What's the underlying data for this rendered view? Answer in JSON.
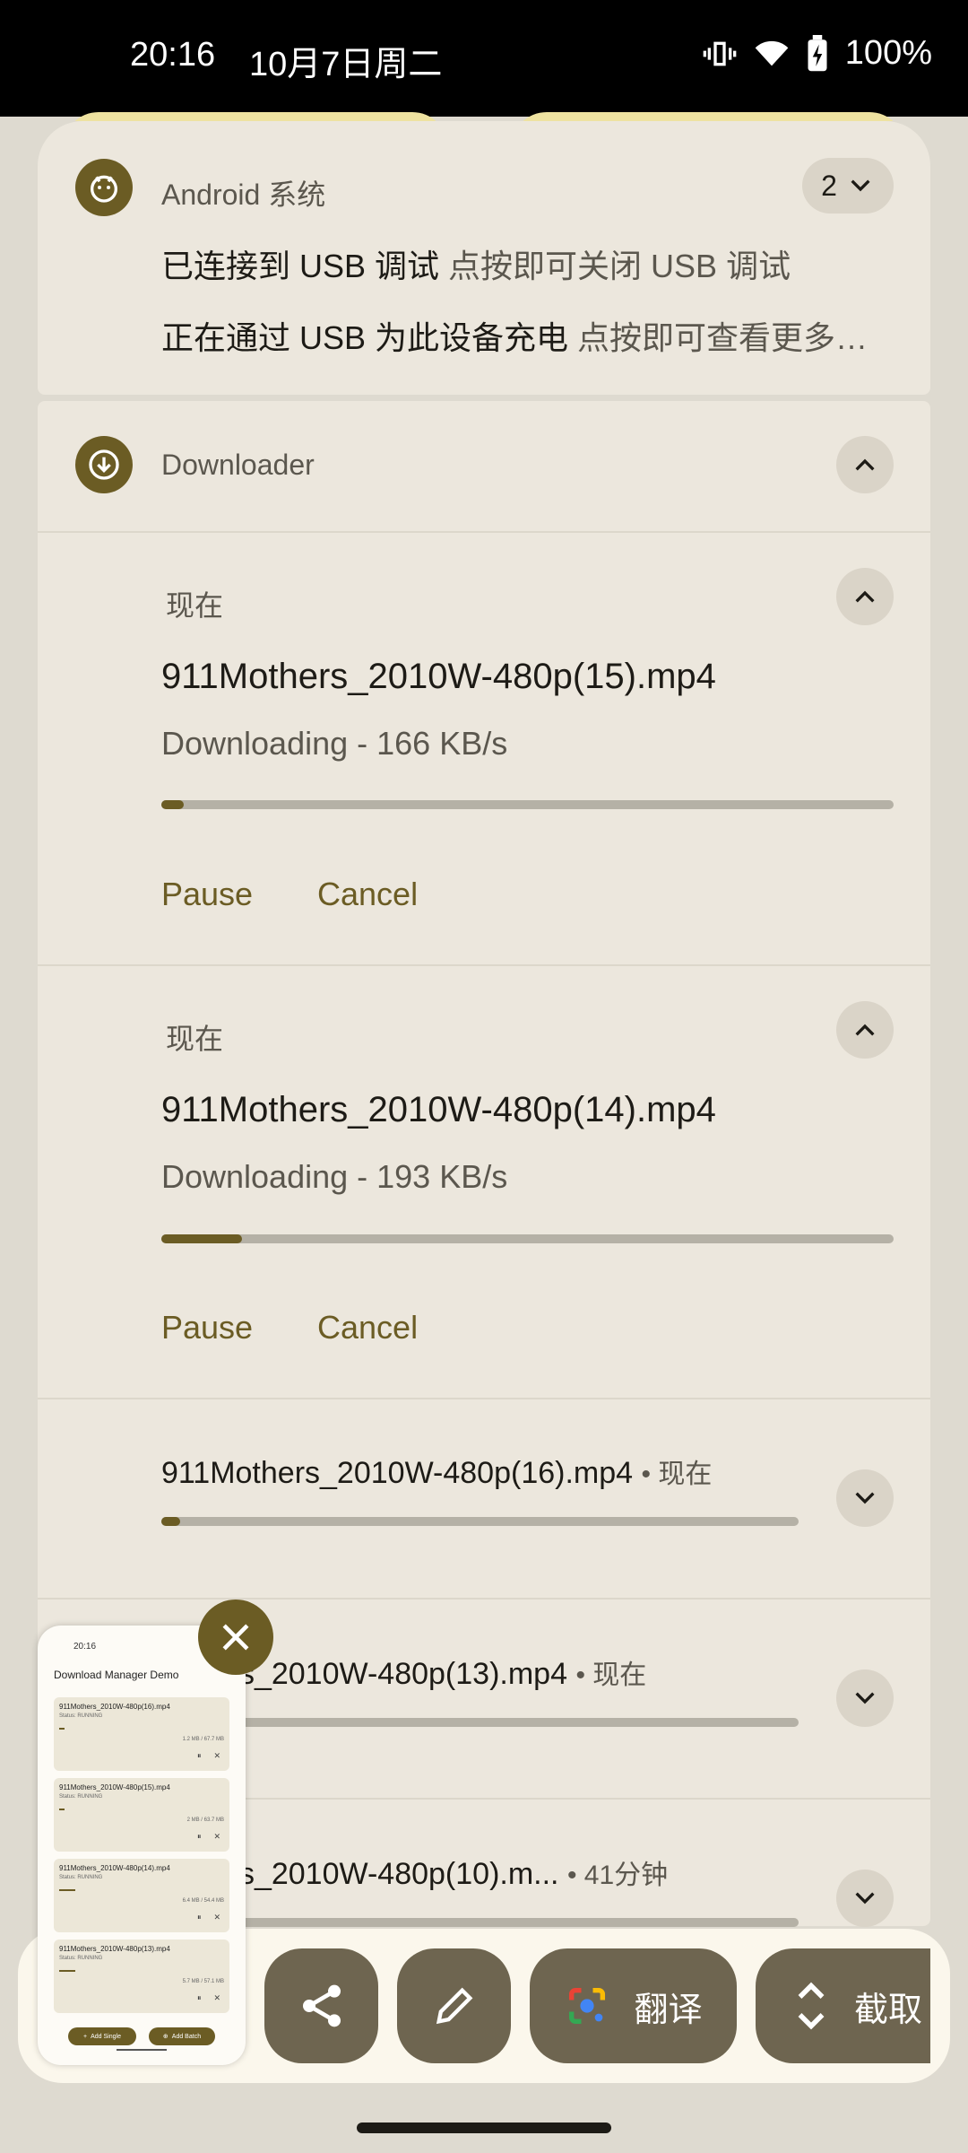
{
  "status_bar": {
    "time": "20:16",
    "date": "10月7日周二",
    "battery": "100%"
  },
  "android_notification": {
    "app_name": "Android 系统",
    "count": "2",
    "line1_title": "已连接到 USB 调试",
    "line1_text": "点按即可关闭 USB 调试",
    "line2_title": "正在通过 USB 为此设备充电",
    "line2_text": "点按即可查看更多…"
  },
  "downloader": {
    "app_name": "Downloader",
    "expanded": [
      {
        "time": "现在",
        "title": "911Mothers_2010W-480p(15).mp4",
        "status": "Downloading - 166 KB/s",
        "progress": 0.03,
        "pause_label": "Pause",
        "cancel_label": "Cancel"
      },
      {
        "time": "现在",
        "title": "911Mothers_2010W-480p(14).mp4",
        "status": "Downloading - 193 KB/s",
        "progress": 0.11,
        "pause_label": "Pause",
        "cancel_label": "Cancel"
      }
    ],
    "collapsed": [
      {
        "title": "911Mothers_2010W-480p(16).mp4",
        "time": "现在",
        "progress": 0.03
      },
      {
        "title": "othe rs_2010W-480p(13).mp4",
        "time": "现在",
        "progress": 0.0
      },
      {
        "title": "othe rs_2010W-480p(10).m...",
        "time": "41分钟",
        "progress": 0.0
      }
    ]
  },
  "screenshot_toolbar": {
    "translate_label": "翻译",
    "capture_label": "截取"
  },
  "preview": {
    "status": "20:16",
    "title": "Download Manager Demo",
    "items": [
      {
        "name": "911Mothers_2010W-480p(16).mp4",
        "sub": "Status: RUNNING",
        "size": "1.2 MB / 67.7 MB"
      },
      {
        "name": "911Mothers_2010W-480p(15).mp4",
        "sub": "Status: RUNNING",
        "size": "2 MB / 63.7 MB"
      },
      {
        "name": "911Mothers_2010W-480p(14).mp4",
        "sub": "Status: RUNNING",
        "size": "6.4 MB / 54.4 MB"
      },
      {
        "name": "911Mothers_2010W-480p(13).mp4",
        "sub": "Status: RUNNING",
        "size": "5.7 MB / 57.1 MB"
      }
    ],
    "add_single": "Add Single",
    "add_batch": "Add Batch"
  },
  "colors": {
    "accent": "#6b5c24",
    "card": "#ece7dd",
    "background": "#dedad0"
  }
}
